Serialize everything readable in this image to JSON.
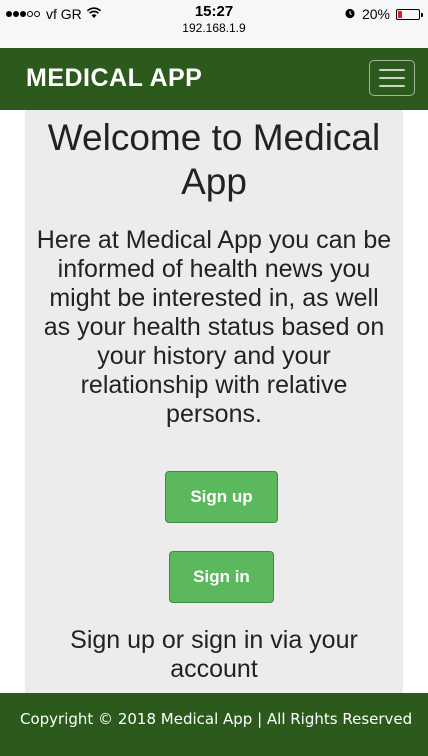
{
  "status_bar": {
    "carrier": "vf GR",
    "signal_bars_filled": 3,
    "signal_bars_total": 5,
    "time": "15:27",
    "url": "192.168.1.9",
    "battery_percent": "20%",
    "battery_level": 0.2,
    "icons": [
      "signal-dots-icon",
      "wifi-icon",
      "alarm-clock-icon",
      "battery-icon"
    ]
  },
  "navbar": {
    "brand": "MEDICAL APP",
    "menu_icon": "hamburger-menu-icon"
  },
  "main": {
    "title": "Welcome to Medical App",
    "intro": "Here at Medical App you can be informed of health news you might be interested in, as well as your health status based on your history and your relationship with relative persons.",
    "signup_label": "Sign up",
    "signin_label": "Sign in",
    "via_text": "Sign up or sign in via your account"
  },
  "footer": {
    "copyright": "Copyright © 2018 Medical App | All Rights Reserved"
  },
  "colors": {
    "navbar_bg": "#2b5a1c",
    "content_bg": "#ececec",
    "button_bg": "#5cb85c",
    "battery_low": "#e02020"
  }
}
